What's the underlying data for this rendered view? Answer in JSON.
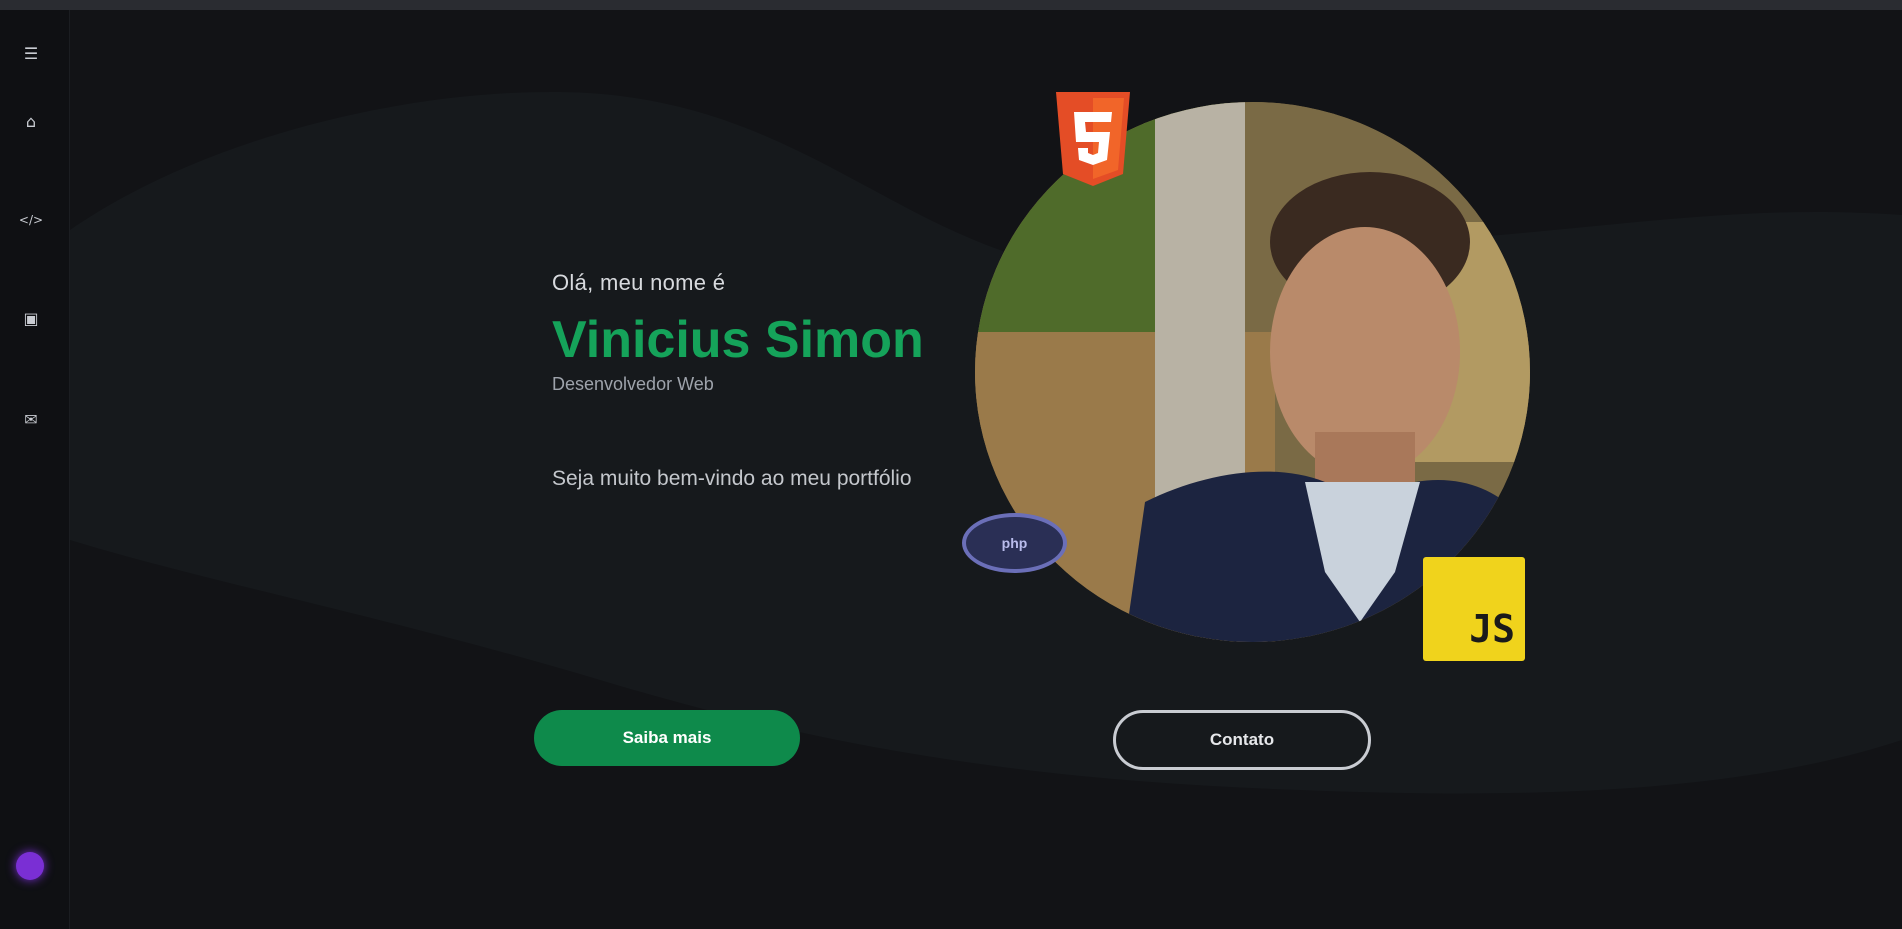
{
  "sidebar": {
    "items": [
      {
        "icon": "menu-icon",
        "glyph": "☰"
      },
      {
        "icon": "home-icon",
        "glyph": "⌂"
      },
      {
        "icon": "code-icon",
        "glyph": "</>"
      },
      {
        "icon": "briefcase-icon",
        "glyph": "▣"
      },
      {
        "icon": "mail-icon",
        "glyph": "✉"
      }
    ],
    "theme_toggle_icon": "theme-toggle-icon",
    "theme_label": ""
  },
  "hero": {
    "greeting": "Olá, meu nome é",
    "name": "Vinicius Simon",
    "role": "Desenvolvedor Web",
    "tagline": "Seja muito bem-vindo ao meu portfólio"
  },
  "badges": {
    "html_icon": "html5-icon",
    "js_label": "JS",
    "other_label": "php"
  },
  "actions": {
    "primary_label": "Saiba mais",
    "secondary_label": "Contato"
  },
  "colors": {
    "background": "#121316",
    "panel": "#16191c",
    "accent_green": "#15a35a",
    "button_green": "#0e8a4b",
    "html_orange": "#e44d26",
    "js_yellow": "#f0d31c",
    "toggle_purple": "#7a2fd4"
  }
}
